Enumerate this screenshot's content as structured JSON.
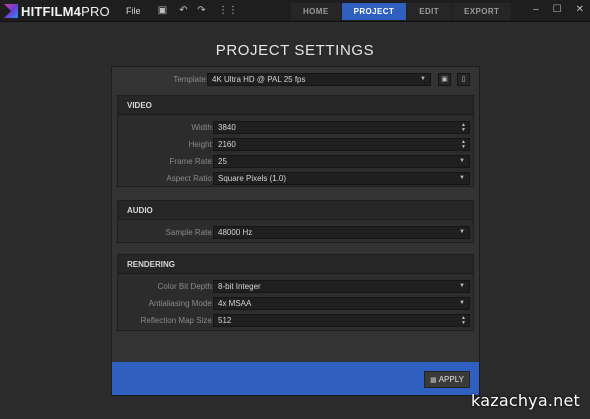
{
  "app": {
    "logo_bold": "HITFILM4",
    "logo_thin": "PRO",
    "menu_file": "File"
  },
  "toolbar": {
    "icons": [
      "save-icon",
      "undo-icon",
      "redo-icon",
      "grid-icon"
    ]
  },
  "tabs": [
    {
      "label": "HOME",
      "active": false
    },
    {
      "label": "PROJECT",
      "active": true
    },
    {
      "label": "EDIT",
      "active": false
    },
    {
      "label": "EXPORT",
      "active": false
    }
  ],
  "window_controls": {
    "minimize": "–",
    "maximize": "☐",
    "close": "✕"
  },
  "page": {
    "title": "PROJECT SETTINGS"
  },
  "template": {
    "label": "Template:",
    "value": "4K Ultra HD @ PAL 25 fps"
  },
  "video": {
    "heading": "VIDEO",
    "width": {
      "label": "Width:",
      "value": "3840"
    },
    "height": {
      "label": "Height:",
      "value": "2160"
    },
    "frame_rate": {
      "label": "Frame Rate:",
      "value": "25"
    },
    "aspect_ratio": {
      "label": "Aspect Ratio:",
      "value": "Square Pixels (1.0)"
    }
  },
  "audio": {
    "heading": "AUDIO",
    "sample_rate": {
      "label": "Sample Rate:",
      "value": "48000 Hz"
    }
  },
  "rendering": {
    "heading": "RENDERING",
    "color_bit_depth": {
      "label": "Color Bit Depth:",
      "value": "8-bit Integer"
    },
    "antialiasing": {
      "label": "Antialiasing Mode:",
      "value": "4x MSAA"
    },
    "reflection_map": {
      "label": "Reflection Map Size:",
      "value": "512"
    }
  },
  "footer": {
    "apply_label": "APPLY"
  },
  "watermark": "kazachya.net",
  "colors": {
    "accent": "#2f5fbf",
    "background": "#2b2b2b",
    "panel": "#333333"
  }
}
